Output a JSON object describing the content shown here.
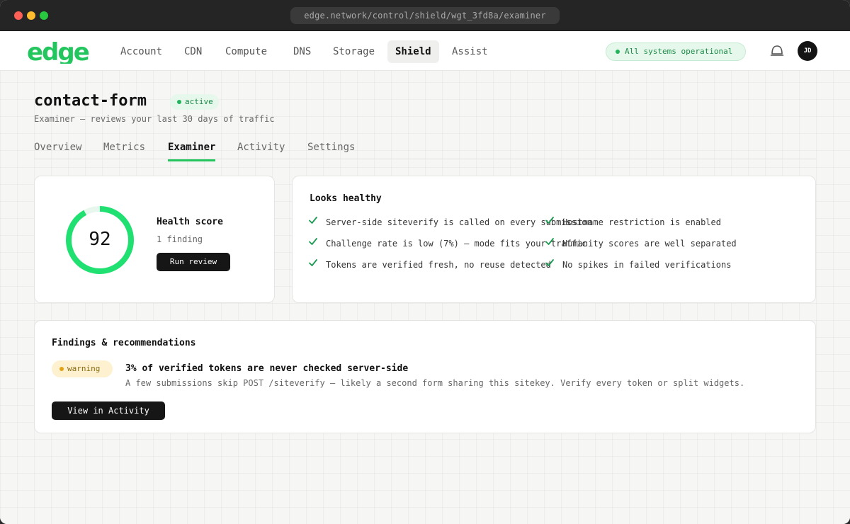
{
  "browser": {
    "url": "edge.network/control/shield/wgt_3fd8a/examiner"
  },
  "nav": {
    "logo": "edge",
    "items": [
      "Account",
      "CDN",
      "Compute",
      "DNS",
      "Storage",
      "Shield",
      "Assist"
    ],
    "active": "Shield",
    "status": "All systems operational",
    "avatar_initials": "JD"
  },
  "page": {
    "title": "contact-form",
    "status_badge": "active",
    "subtitle": "Examiner — reviews your last 30 days of traffic",
    "tabs": [
      "Overview",
      "Metrics",
      "Examiner",
      "Activity",
      "Settings"
    ],
    "active_tab": "Examiner"
  },
  "score_card": {
    "score": "92",
    "score_value": 92,
    "label": "Health score",
    "finding_count": "1 finding",
    "run_button": "Run review"
  },
  "healthy_card": {
    "title": "Looks healthy",
    "checks": [
      "Server-side siteverify is called on every submission",
      "Challenge rate is low (7%) — mode fits your traffic",
      "Tokens are verified fresh, no reuse detected",
      "Hostname restriction is enabled",
      "Humanity scores are well separated",
      "No spikes in failed verifications"
    ]
  },
  "findings_card": {
    "title": "Findings & recommendations",
    "items": [
      {
        "severity": "warning",
        "title": "3% of verified tokens are never checked server-side",
        "description": "A few submissions skip POST /siteverify — likely a second form sharing this sitekey. Verify every token or split widgets."
      }
    ],
    "view_button": "View in Activity"
  },
  "colors": {
    "accent": "#22c55e",
    "ring": "#1fe070",
    "ring_track": "#e8f7ee",
    "warning": "#e3a316"
  }
}
